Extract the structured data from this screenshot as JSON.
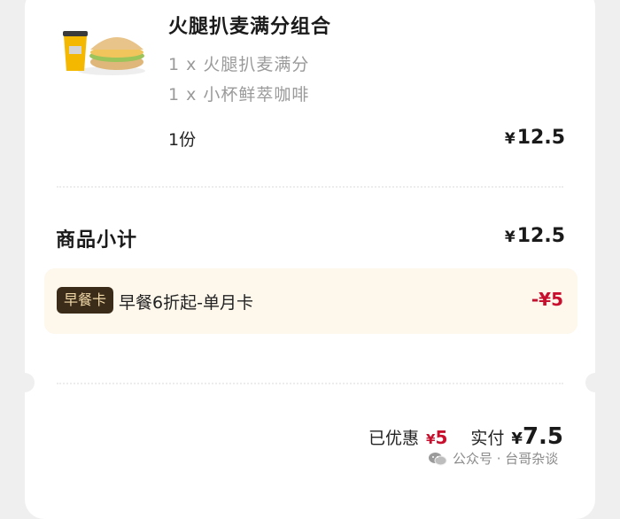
{
  "product": {
    "name": "火腿扒麦满分组合",
    "items": [
      "1 x 火腿扒麦满分",
      "1 x 小杯鲜萃咖啡"
    ],
    "quantity": "1份",
    "price": "12.5"
  },
  "currency": "¥",
  "subtotal": {
    "label": "商品小计",
    "amount": "12.5"
  },
  "discount": {
    "badge": "早餐卡",
    "text": "早餐6折起-单月卡",
    "amount": "-¥5"
  },
  "summary": {
    "saved_label": "已优惠",
    "saved_amount": "5",
    "paid_label": "实付",
    "paid_amount": "7.5"
  },
  "watermark": "公众号 · 台哥杂谈",
  "colors": {
    "accent_red": "#c8102e",
    "badge_bg": "#3b2c1a",
    "badge_text": "#f1d9a8",
    "discount_bg": "#fdf7ec"
  },
  "icons": {
    "watermark_icon": "wechat-icon"
  }
}
